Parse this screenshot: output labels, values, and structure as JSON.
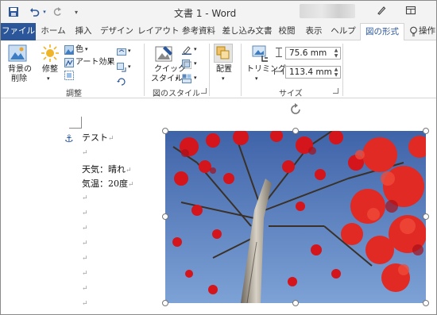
{
  "window": {
    "title": "文書 1 - Word"
  },
  "tabs": [
    {
      "label": "ファイル",
      "type": "file"
    },
    {
      "label": "ホーム"
    },
    {
      "label": "挿入"
    },
    {
      "label": "デザイン"
    },
    {
      "label": "レイアウト"
    },
    {
      "label": "参考資料"
    },
    {
      "label": "差し込み文書"
    },
    {
      "label": "校閲"
    },
    {
      "label": "表示"
    },
    {
      "label": "ヘルプ"
    },
    {
      "label": "図の形式",
      "active": true
    },
    {
      "label": "操作"
    }
  ],
  "ribbon": {
    "remove_background": [
      "背景の",
      "削除"
    ],
    "corrections": "修整",
    "color": "色",
    "artistic_effects": "アート効果",
    "quick_styles": [
      "クイック",
      "スタイル"
    ],
    "arrange": "配置",
    "crop": "トリミング",
    "height_value": "75.6 mm",
    "width_value": "113.4 mm",
    "groups": {
      "adjust": "調整",
      "picture_styles": "図のスタイル",
      "size": "サイズ"
    }
  },
  "document": {
    "lines": [
      "テスト",
      "",
      "天気：晴れ",
      "気温：20度",
      "",
      "",
      "",
      "",
      "",
      "",
      "",
      "",
      ""
    ],
    "paragraph_mark": "↵"
  },
  "colors": {
    "accent": "#2b579a",
    "file_tab": "#2b579a"
  }
}
